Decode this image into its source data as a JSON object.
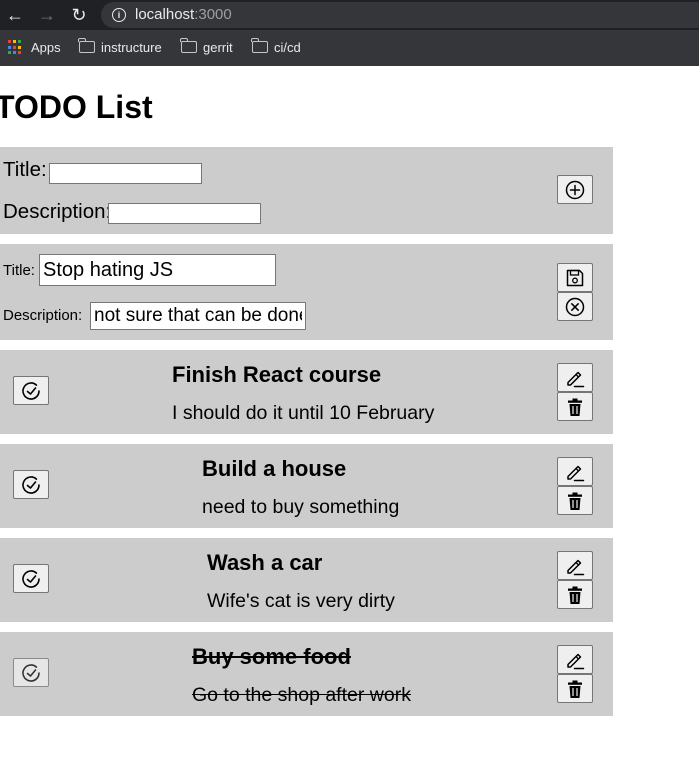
{
  "browser": {
    "back_icon": "arrow-left-icon",
    "forward_icon": "arrow-right-icon",
    "reload_icon": "reload-icon",
    "info_icon": "info-icon",
    "url_host": "localhost",
    "url_port": ":3000",
    "bookmarks": [
      {
        "label": "Apps",
        "icon": "apps-grid-icon"
      },
      {
        "label": "instructure",
        "icon": "folder-icon"
      },
      {
        "label": "gerrit",
        "icon": "folder-icon"
      },
      {
        "label": "ci/cd",
        "icon": "folder-icon"
      }
    ]
  },
  "page": {
    "title": "TODO List"
  },
  "add_form": {
    "title_label": "Title:",
    "title_value": "",
    "description_label": "Description:",
    "description_value": "",
    "add_icon": "plus-circle-icon"
  },
  "edit_form": {
    "title_label": "Title:",
    "title_value": "Stop hating JS",
    "description_label": "Description:",
    "description_value": "not sure that can be done",
    "save_icon": "floppy-disk-icon",
    "cancel_icon": "x-circle-icon"
  },
  "todos": [
    {
      "title": "Finish React course",
      "description": "I should do it until 10 February",
      "completed": false
    },
    {
      "title": "Build a house",
      "description": "need to buy something",
      "completed": false
    },
    {
      "title": "Wash a car",
      "description": "Wife's cat is very dirty",
      "completed": false
    },
    {
      "title": "Buy some food",
      "description": "Go to the shop after work",
      "completed": true
    }
  ],
  "todo_icons": {
    "complete": "check-circle-icon",
    "edit": "pencil-icon",
    "delete": "trash-icon"
  },
  "colors": {
    "panel_bg": "#cccccc",
    "chrome_dark": "#202124",
    "chrome_bar": "#35363a"
  }
}
